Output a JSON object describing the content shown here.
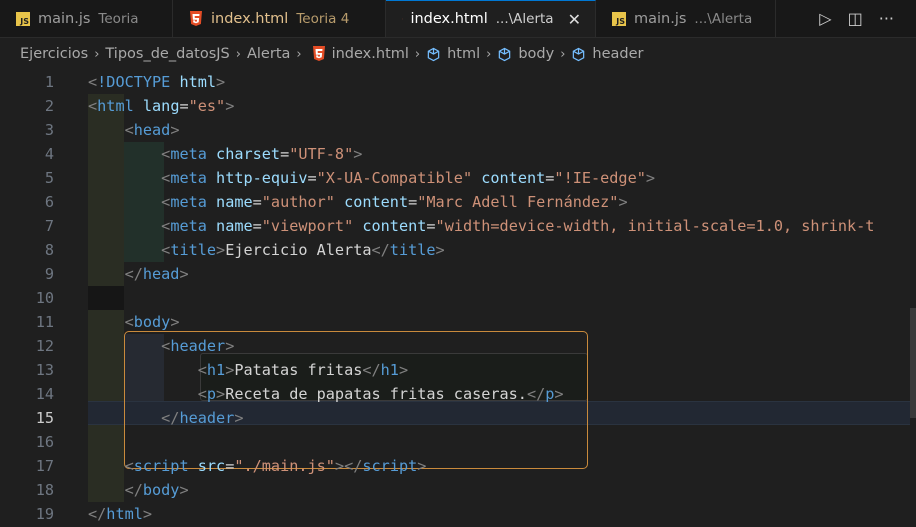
{
  "tabs": [
    {
      "icon": "js-icon",
      "name": "main.js",
      "desc": "Teoria",
      "modified": false,
      "active": false
    },
    {
      "icon": "html5-icon",
      "name": "index.html",
      "desc": "Teoria 4",
      "modified": true,
      "active": false
    },
    {
      "icon": "html5-icon",
      "name": "index.html",
      "desc": "...\\Alerta",
      "modified": false,
      "active": true
    },
    {
      "icon": "js-icon",
      "name": "main.js",
      "desc": "...\\Alerta",
      "modified": false,
      "active": false
    }
  ],
  "close_glyph": "✕",
  "actions": {
    "run": "▷",
    "split": "◫",
    "more": "···"
  },
  "breadcrumb": [
    "Ejercicios",
    "Tipos_de_datosJS",
    "Alerta",
    "index.html",
    "html",
    "body",
    "header"
  ],
  "crumb_sep": "›",
  "editor": {
    "current_line": 15,
    "lines": [
      {
        "n": "1"
      },
      {
        "n": "2"
      },
      {
        "n": "3"
      },
      {
        "n": "4"
      },
      {
        "n": "5"
      },
      {
        "n": "6"
      },
      {
        "n": "7"
      },
      {
        "n": "8"
      },
      {
        "n": "9"
      },
      {
        "n": "10"
      },
      {
        "n": "11"
      },
      {
        "n": "12"
      },
      {
        "n": "13"
      },
      {
        "n": "14"
      },
      {
        "n": "15"
      },
      {
        "n": "16"
      },
      {
        "n": "17"
      },
      {
        "n": "18"
      },
      {
        "n": "19"
      }
    ],
    "tokens": {
      "doctype": "!DOCTYPE",
      "html": "html",
      "lang": "lang",
      "es": "\"es\"",
      "head": "head",
      "meta": "meta",
      "charset": "charset",
      "utf8": "\"UTF-8\"",
      "http_equiv": "http-equiv",
      "xua": "\"X-UA-Compatible\"",
      "content": "content",
      "ie_edge": "\"!IE-edge\"",
      "name": "name",
      "author": "\"author\"",
      "author_val": "\"Marc Adell Fernández\"",
      "viewport": "\"viewport\"",
      "viewport_val": "\"width=device-width, initial-scale=1.0, shrink-t",
      "title": "title",
      "title_text": "Ejercicio Alerta",
      "body": "body",
      "header": "header",
      "h1": "h1",
      "h1_text": "Patatas fritas",
      "p": "p",
      "p_text": "Receta de papatas fritas caseras.",
      "script": "script",
      "src": "src",
      "src_val": "\"./main.js\""
    }
  }
}
